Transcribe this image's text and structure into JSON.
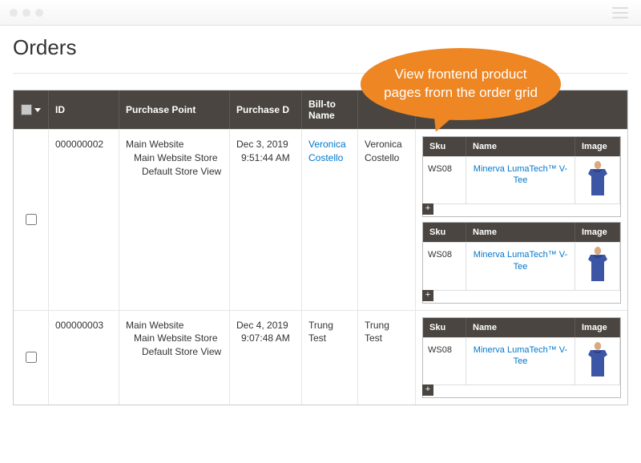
{
  "page": {
    "title": "Orders"
  },
  "bubble": {
    "text": "View frontend product pages frorn the order grid"
  },
  "grid": {
    "headers": {
      "id": "ID",
      "purchase_point": "Purchase Point",
      "purchase_date": "Purchase D",
      "bill_to": "Bill-to Name",
      "ship_to": ""
    },
    "mini_headers": {
      "sku": "Sku",
      "name": "Name",
      "image": "Image"
    },
    "rows": [
      {
        "id": "000000002",
        "purchase_point": {
          "l1": "Main Website",
          "l2": "Main Website Store",
          "l3": "Default Store View"
        },
        "purchase_date": {
          "d": "Dec 3, 2019",
          "t": "9:51:44 AM"
        },
        "bill_to": {
          "first": "Veronica",
          "last": "Costello"
        },
        "ship_to": {
          "first": "Veronica",
          "last": "Costello"
        },
        "products": [
          {
            "sku": "WS08",
            "name": "Minerva LumaTech™ V-Tee"
          },
          {
            "sku": "WS08",
            "name": "Minerva LumaTech™ V-Tee"
          }
        ]
      },
      {
        "id": "000000003",
        "purchase_point": {
          "l1": "Main Website",
          "l2": "Main Website Store",
          "l3": "Default Store View"
        },
        "purchase_date": {
          "d": "Dec 4, 2019",
          "t": "9:07:48 AM"
        },
        "bill_to": {
          "first": "Trung",
          "last": "Test"
        },
        "ship_to": {
          "first": "Trung Test",
          "last": ""
        },
        "products": [
          {
            "sku": "WS08",
            "name": "Minerva LumaTech™ V-Tee"
          }
        ]
      }
    ]
  }
}
